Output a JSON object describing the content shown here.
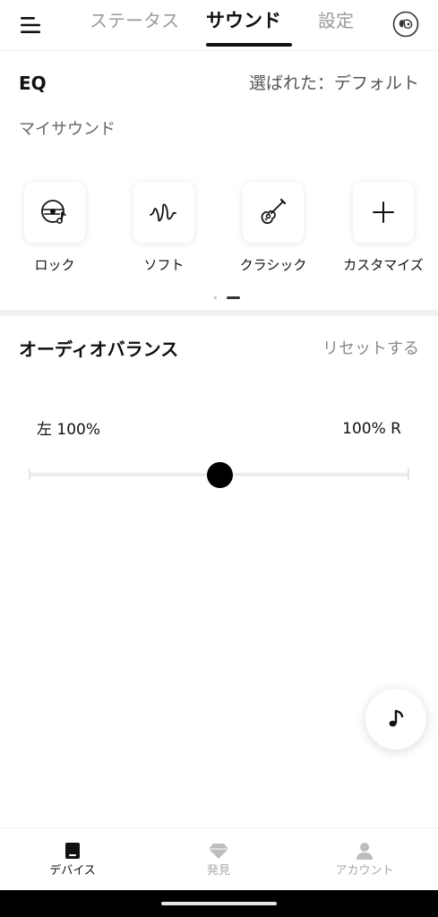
{
  "header": {
    "tabs": [
      {
        "label": "ステータス",
        "active": false
      },
      {
        "label": "サウンド",
        "active": true
      },
      {
        "label": "設定",
        "active": false
      }
    ],
    "menu_icon": "menu-icon",
    "profile_icon": "earbuds-profile-icon"
  },
  "eq": {
    "title": "EQ",
    "selected": "選ばれた：デフォルト",
    "section_label": "マイサウンド",
    "presets": [
      {
        "label": "ロック",
        "icon": "vinyl-record-icon"
      },
      {
        "label": "ソフト",
        "icon": "soft-wave-icon"
      },
      {
        "label": "クラシック",
        "icon": "guitar-icon"
      },
      {
        "label": "カスタマイズ",
        "icon": "plus-icon"
      }
    ],
    "pager": {
      "pages": 2,
      "current": 2
    }
  },
  "balance": {
    "title": "オーディオバランス",
    "reset_label": "リセットする",
    "left_label": "左 100%",
    "right_label": "100% R",
    "value_percent": 50
  },
  "music_button_icon": "music-note-icon",
  "bottom_nav": [
    {
      "label": "デバイス",
      "icon": "device-icon",
      "active": true
    },
    {
      "label": "発見",
      "icon": "diamond-icon",
      "active": false
    },
    {
      "label": "アカウント",
      "icon": "person-icon",
      "active": false
    }
  ],
  "colors": {
    "active_text": "#111111",
    "inactive_text": "#9b9b9b",
    "slider_thumb": "#000000",
    "slider_track": "#ececec"
  }
}
